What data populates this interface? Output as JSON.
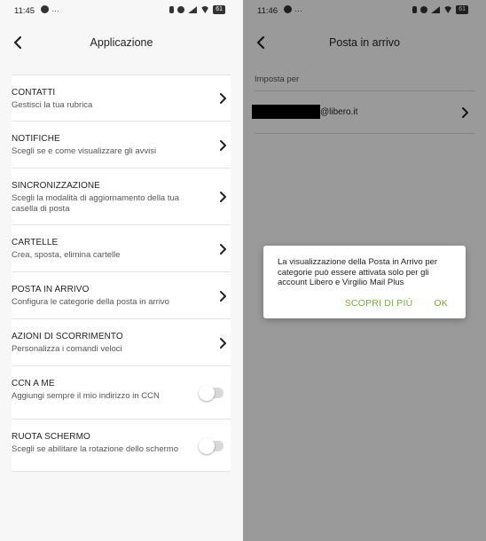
{
  "colors": {
    "accent": "#7ea93a",
    "text": "#1f1f1f",
    "subtext": "#555555"
  },
  "left": {
    "status": {
      "time": "11:45",
      "extra": "…",
      "battery": "61"
    },
    "title": "Applicazione",
    "items": [
      {
        "title": "CONTATTI",
        "subtitle": "Gestisci la tua rubrica",
        "control": "chevron"
      },
      {
        "title": "NOTIFICHE",
        "subtitle": "Scegli se e come visualizzare gli avvisi",
        "control": "chevron"
      },
      {
        "title": "SINCRONIZZAZIONE",
        "subtitle": "Scegli la modalità di aggiornamento della tua casella di posta",
        "control": "chevron"
      },
      {
        "title": "CARTELLE",
        "subtitle": "Crea, sposta, elimina cartelle",
        "control": "chevron"
      },
      {
        "title": "POSTA IN ARRIVO",
        "subtitle": "Configura le categorie della posta in arrivo",
        "control": "chevron"
      },
      {
        "title": "AZIONI DI SCORRIMENTO",
        "subtitle": "Personalizza i comandi veloci",
        "control": "chevron"
      },
      {
        "title": "CCN A ME",
        "subtitle": "Aggiungi sempre il mio indirizzo in CCN",
        "control": "toggle",
        "on": false
      },
      {
        "title": "RUOTA SCHERMO",
        "subtitle": "Scegli se abilitare la rotazione dello schermo",
        "control": "toggle",
        "on": false
      }
    ]
  },
  "right": {
    "status": {
      "time": "11:46",
      "extra": "…",
      "battery": "61"
    },
    "title": "Posta in arrivo",
    "section_label": "Imposta per",
    "account_email": "@libero.it",
    "dialog": {
      "message": "La visualizzazione della Posta in Arrivo per categorie può essere attivata solo per gli account Libero e Virgilio Mail Plus",
      "learn_more": "SCOPRI DI PIÙ",
      "ok": "OK"
    }
  }
}
